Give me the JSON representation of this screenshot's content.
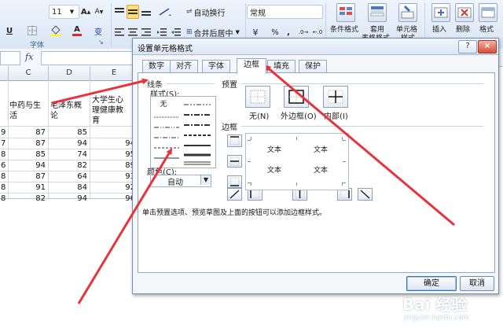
{
  "ribbon": {
    "font_size": "11",
    "wrap_text": "自动换行",
    "merge_center": "合并后居中",
    "number_format": "常规",
    "percent": "%",
    "comma": ",",
    "font_group_label": "字体",
    "conditional_format": "条件格式",
    "format_as_table": "套用",
    "format_as_table_sub": "表格格式",
    "cell_styles": "单元格",
    "cell_styles_sub": "样式",
    "insert": "插入",
    "delete": "删除",
    "format": "格式",
    "underline": "U",
    "font_color_letter": "A",
    "currency_glyph": "变"
  },
  "formula_bar": {
    "fx": "fx"
  },
  "sheet": {
    "columns": [
      "C",
      "D",
      "E"
    ],
    "headers": [
      [
        "中药与生",
        "活"
      ],
      [
        "毛泽东概",
        "论"
      ],
      [
        "大学生心",
        "理健康教",
        "育"
      ]
    ],
    "left_column_partial": [
      "9",
      "7",
      "8",
      "6",
      "8",
      "8",
      "8"
    ],
    "rows": [
      [
        "87",
        "85",
        ""
      ],
      [
        "87",
        "94",
        "94"
      ],
      [
        "85",
        "74",
        "95"
      ],
      [
        "94",
        "82",
        "89"
      ],
      [
        "87",
        "64",
        "93"
      ],
      [
        "91",
        "84",
        "92"
      ],
      [
        "82",
        "94",
        "96"
      ]
    ]
  },
  "dialog": {
    "title": "设置单元格格式",
    "help": "?",
    "close": "×",
    "tabs": [
      "数字",
      "对齐",
      "字体",
      "边框",
      "填充",
      "保护"
    ],
    "active_tab": "边框",
    "line_section": "线条",
    "style_label": "样式(S):",
    "none_label": "无",
    "color_label": "颜色(C):",
    "color_value": "自动",
    "presets_section": "预置",
    "preset_none": "无(N)",
    "preset_outline": "外边框(O)",
    "preset_inside": "内部(I)",
    "border_section": "边框",
    "preview_text": [
      "文本",
      "文本",
      "文本",
      "文本"
    ],
    "hint": "单击预置选项、预览草图及上面的按钮可以添加边框样式。",
    "ok": "确定",
    "cancel": "取消"
  },
  "watermark": {
    "text": "Bai 经验",
    "url": "jingyan.baidu.com"
  },
  "colors": {
    "arrow": "#e8333c",
    "ribbon_bg": "#dae6f5",
    "dialog_border": "#6f8fb8"
  }
}
